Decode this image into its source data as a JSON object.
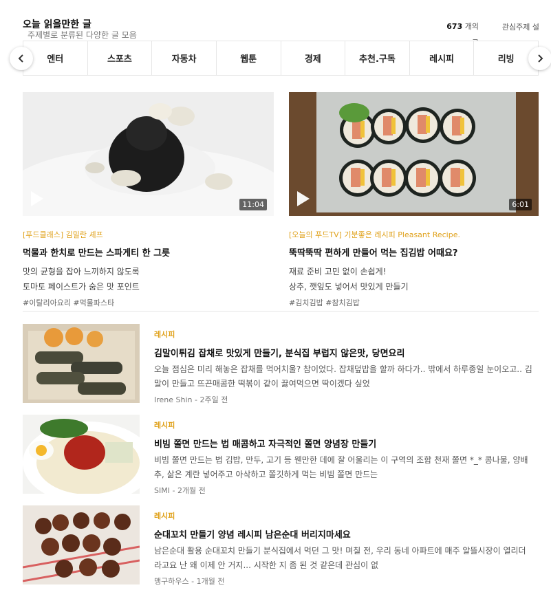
{
  "header": {
    "title": "오늘 읽을만한 글",
    "subtitle": "주제별로 분류된 다양한 글 모음",
    "count_number": "673",
    "count_suffix": "개의 글",
    "topic_setting": "관심주제 설정"
  },
  "categories": [
    "엔터",
    "스포츠",
    "자동차",
    "웹툰",
    "경제",
    "추천.구독",
    "레시피",
    "리빙"
  ],
  "features": [
    {
      "source": "[푸드클래스] 김밀란 셰프",
      "title": "먹물과 한치로 만드는 스파게티 한 그릇",
      "desc_line1": "맛의 균형을 잡아 느끼하지 않도록",
      "desc_line2": "토마토 페이스트가 숨은 맛 포인트",
      "tags": "#이탈리아요리 #먹물파스타",
      "duration": "11:04"
    },
    {
      "source": "[오늘의 푸드TV] 기분좋은 레시피 Pleasant Recipe.",
      "title": "뚝딱뚝딱 편하게 만들어 먹는 집김밥 어때요?",
      "desc_line1": "재료 준비 고민 없이 손쉽게!",
      "desc_line2": "상추, 깻잎도 넣어서 맛있게 만들기",
      "tags": "#김치김밥 #참치김밥",
      "duration": "6:01"
    }
  ],
  "articles": [
    {
      "category": "레시피",
      "title": "김말이튀김 잡채로 맛있게 만들기, 분식집 부럽지 않은맛, 당면요리",
      "snippet": "오늘 점심은 미리 해놓은 잡채를 먹어치울? 참이었다. 잡채덮밥을 할까 하다가.. 밖에서 하루종일 눈이오고.. 김말이 만들고 뜨끈매콤한 떡볶이 같이 끓여먹으면 딱이겠다 싶었",
      "author": "Irene Shin",
      "time": "2주일 전"
    },
    {
      "category": "레시피",
      "title": "비빔 쫄면 만드는 법 매콤하고 자극적인 쫄면 양념장 만들기",
      "snippet": "비빔 쫄면 만드는 법 김밥, 만두, 고기 등 웬만한 데에 잘 어울리는 이 구역의 조합 천재 쫄면 *_* 콩나물, 양배추, 삶은 계란 넣어주고 아삭하고 쫄깃하게 먹는 비빔 쫄면 만드는",
      "author": "SIMI",
      "time": "2개월 전"
    },
    {
      "category": "레시피",
      "title": "순대꼬치 만들기 양념 레시피 남은순대 버리지마세요",
      "snippet": "남은순대 활용 순대꼬치 만들기 분식집에서 먹던 그 맛! 며칠 전, 우리 동네 아파트에 매주 알뜰시장이 열리더라고요 난 왜 이제 안 거지... 시작한 지 좀 된 것 같은데 관심이 없",
      "author": "맹구하우스",
      "time": "1개월 전"
    }
  ],
  "meta_separator": " - ",
  "icons": {
    "prev": "chevron-left-icon",
    "next": "chevron-right-icon",
    "play": "play-icon"
  },
  "colors": {
    "accent": "#e0a21c",
    "border": "#e6e6e6"
  }
}
